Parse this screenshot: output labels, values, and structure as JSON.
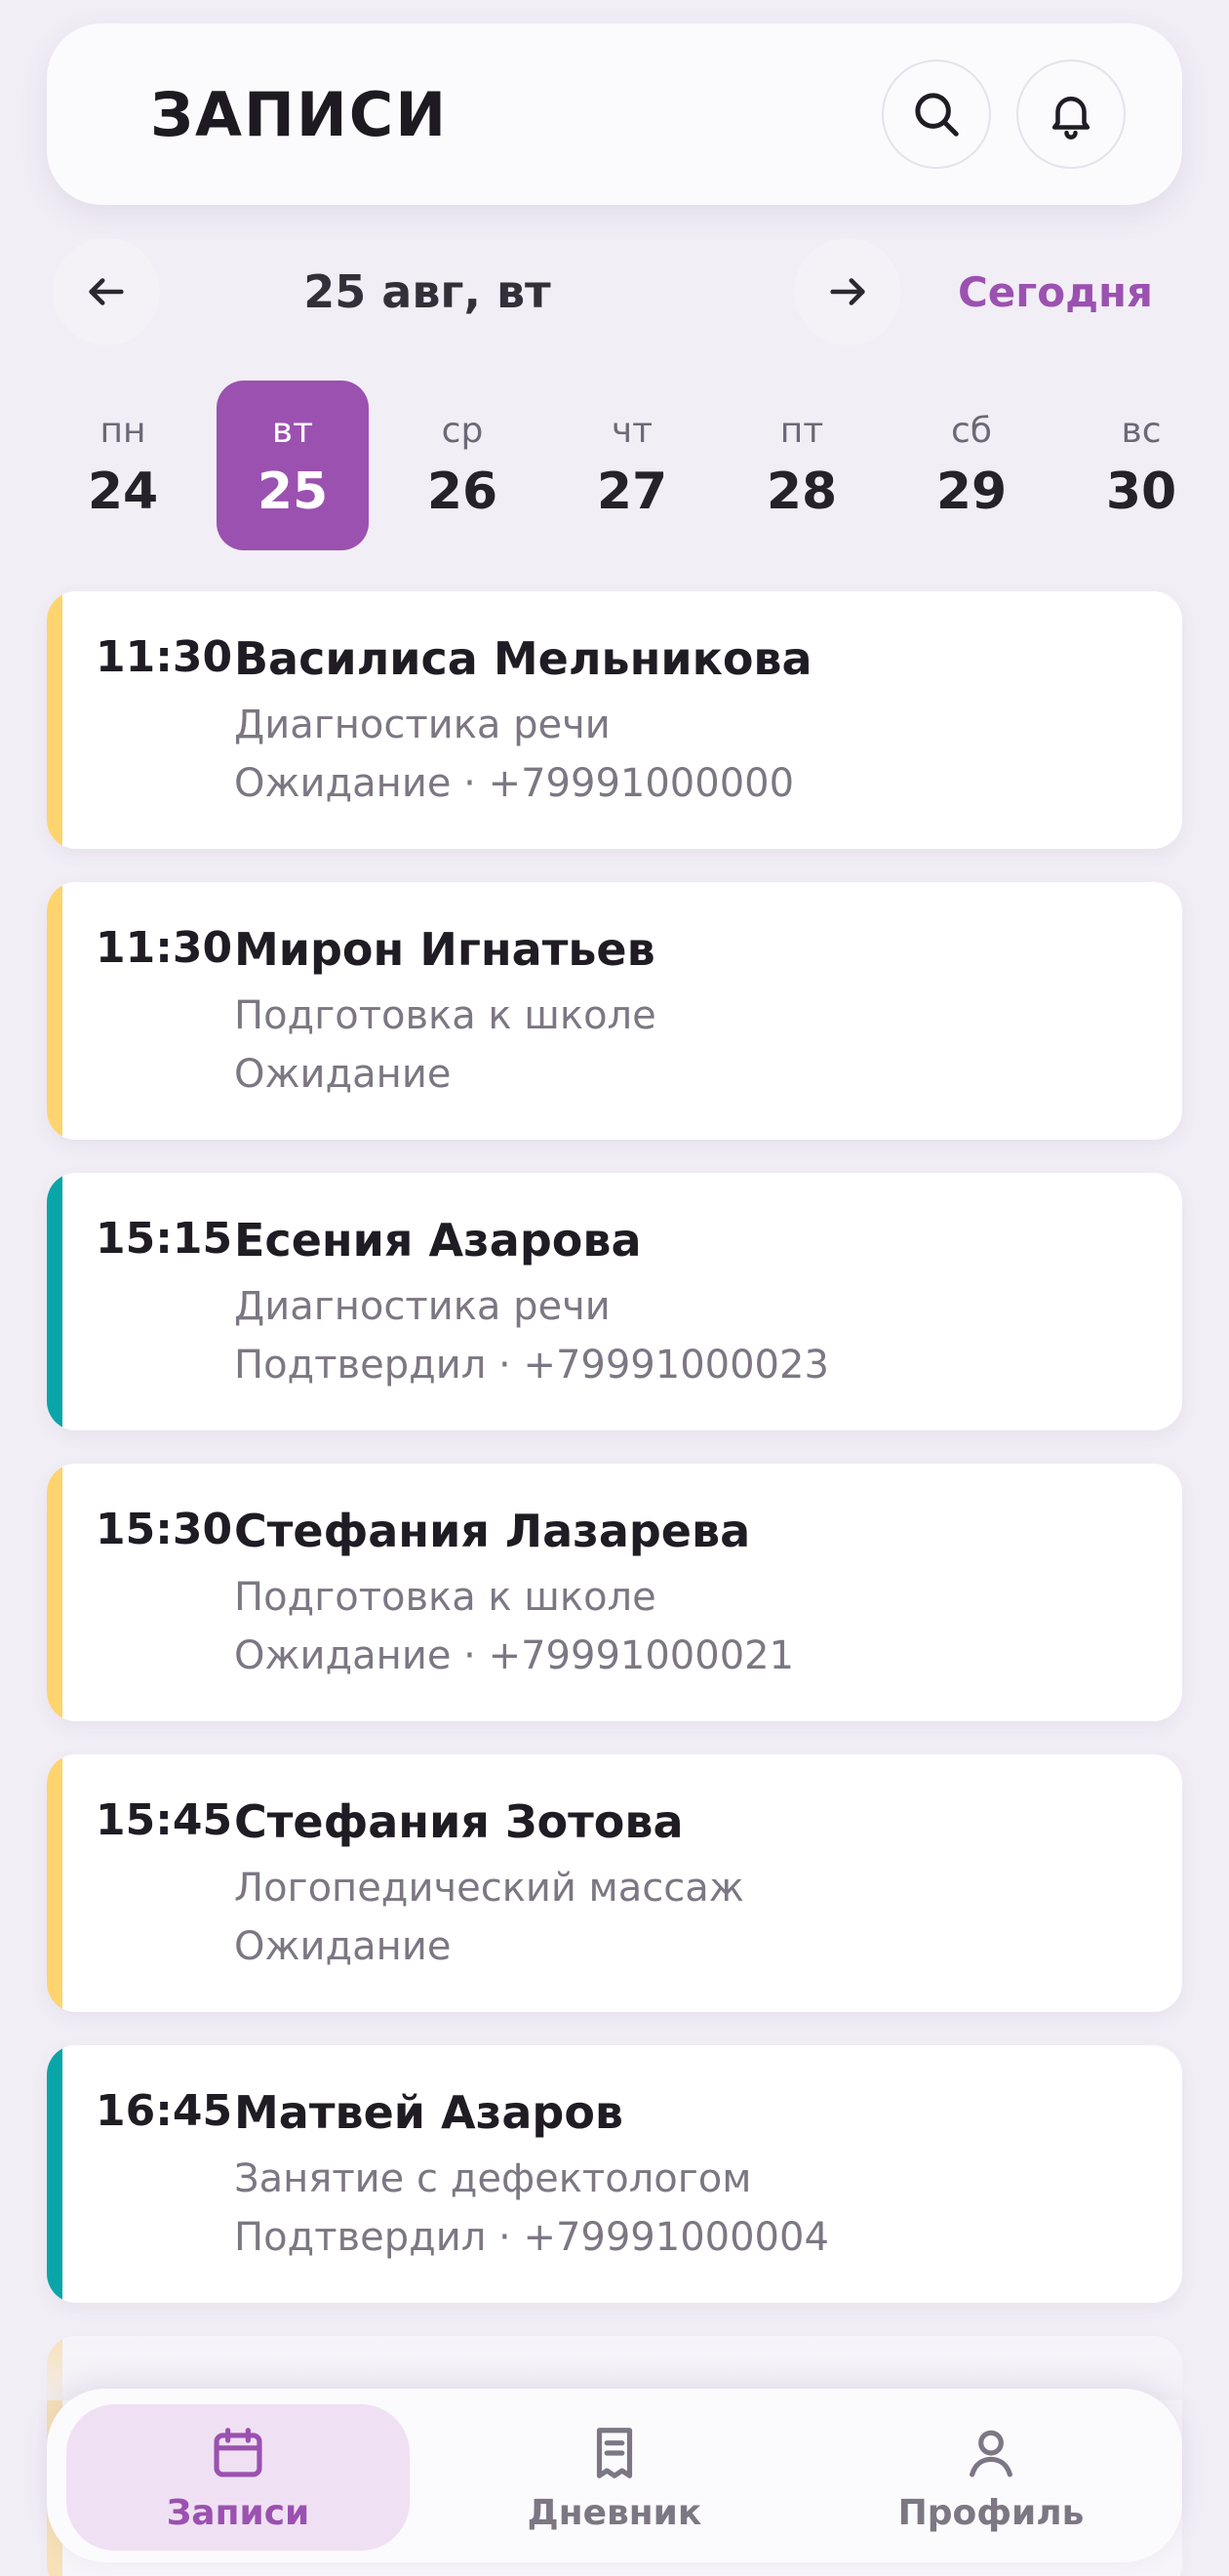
{
  "header": {
    "title": "ЗАПИСИ",
    "search_icon": "search-icon",
    "bell_icon": "bell-icon"
  },
  "date_nav": {
    "current": "25 авг, вт",
    "today": "Сегодня"
  },
  "week": [
    {
      "dow": "пн",
      "num": "24",
      "selected": false
    },
    {
      "dow": "вт",
      "num": "25",
      "selected": true
    },
    {
      "dow": "ср",
      "num": "26",
      "selected": false
    },
    {
      "dow": "чт",
      "num": "27",
      "selected": false
    },
    {
      "dow": "пт",
      "num": "28",
      "selected": false
    },
    {
      "dow": "сб",
      "num": "29",
      "selected": false
    },
    {
      "dow": "вс",
      "num": "30",
      "selected": false
    }
  ],
  "appointments": [
    {
      "time": "11:30",
      "name": "Василиса Мельникова",
      "service": "Диагностика речи",
      "status": "Ожидание · +79991000000",
      "color": "#ffd36e"
    },
    {
      "time": "11:30",
      "name": "Мирон Игнатьев",
      "service": "Подготовка к школе",
      "status": "Ожидание",
      "color": "#ffd36e"
    },
    {
      "time": "15:15",
      "name": "Есения Азарова",
      "service": "Диагностика речи",
      "status": "Подтвердил · +79991000023",
      "color": "#0aa5a8"
    },
    {
      "time": "15:30",
      "name": "Стефания Лазарева",
      "service": "Подготовка к школе",
      "status": "Ожидание · +79991000021",
      "color": "#ffd36e"
    },
    {
      "time": "15:45",
      "name": "Стефания Зотова",
      "service": "Логопедический массаж",
      "status": "Ожидание",
      "color": "#ffd36e"
    },
    {
      "time": "16:45",
      "name": "Матвей Азаров",
      "service": "Занятие с дефектологом",
      "status": "Подтвердил · +79991000004",
      "color": "#0aa5a8"
    }
  ],
  "bottom_nav": {
    "items": [
      {
        "label": "Записи",
        "icon": "calendar-icon",
        "active": true
      },
      {
        "label": "Дневник",
        "icon": "diary-icon",
        "active": false
      },
      {
        "label": "Профиль",
        "icon": "profile-icon",
        "active": false
      }
    ]
  },
  "colors": {
    "accent": "#9b51b0",
    "pending": "#ffd36e",
    "confirmed": "#0aa5a8"
  }
}
